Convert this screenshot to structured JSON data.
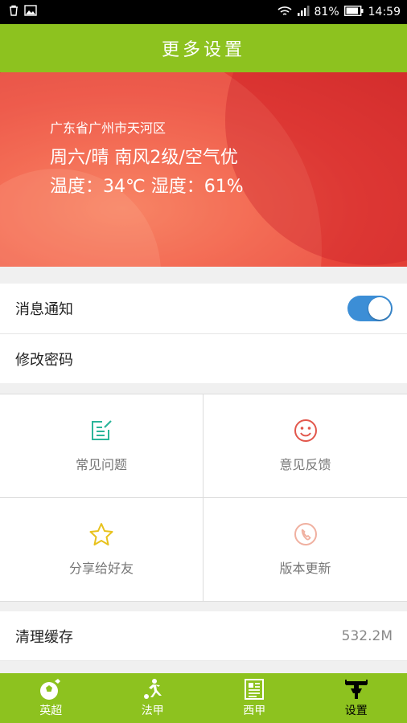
{
  "status_bar": {
    "battery_percent": "81%",
    "time": "14:59",
    "icons": [
      "trash-icon",
      "image-icon",
      "wifi-icon",
      "signal-icon",
      "battery-icon"
    ]
  },
  "header": {
    "title": "更多设置"
  },
  "weather": {
    "location": "广东省广州市天河区",
    "condition": "周六/晴 南风2级/空气优",
    "temp_humidity": "温度：34℃ 湿度：61%"
  },
  "settings": {
    "notification_label": "消息通知",
    "notification_enabled": true,
    "password_label": "修改密码"
  },
  "grid": {
    "items": [
      {
        "label": "常见问题",
        "icon": "edit-note-icon",
        "color": "#2bb59a"
      },
      {
        "label": "意见反馈",
        "icon": "smiley-icon",
        "color": "#e2574c"
      },
      {
        "label": "分享给好友",
        "icon": "star-icon",
        "color": "#e8c21d"
      },
      {
        "label": "版本更新",
        "icon": "phone-icon",
        "color": "#f0b0a0"
      }
    ]
  },
  "cache": {
    "label": "清理缓存",
    "value": "532.2M"
  },
  "tabs": [
    {
      "label": "英超",
      "icon": "soccer-ball-icon"
    },
    {
      "label": "法甲",
      "icon": "player-kick-icon"
    },
    {
      "label": "西甲",
      "icon": "newspaper-icon"
    },
    {
      "label": "设置",
      "icon": "settings-tool-icon",
      "active": true
    }
  ],
  "colors": {
    "accent": "#8dc21f",
    "toggle": "#3c8ed6"
  }
}
